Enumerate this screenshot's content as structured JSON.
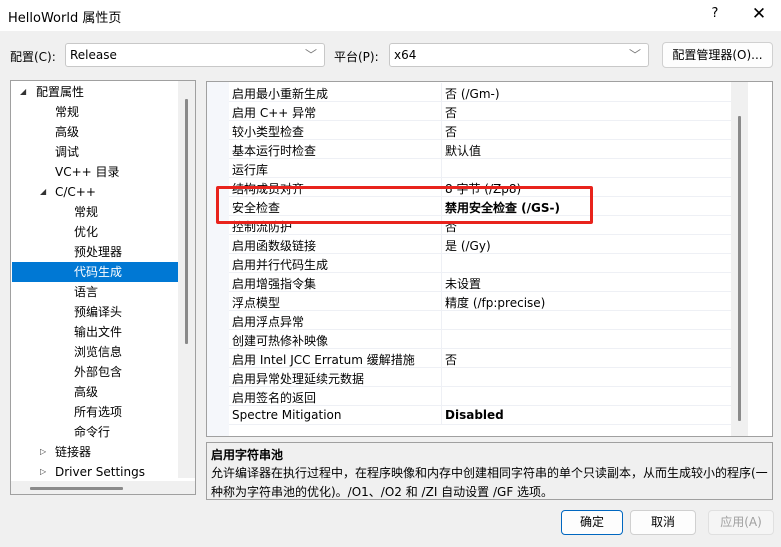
{
  "window": {
    "title": "HelloWorld 属性页",
    "help_label": "?",
    "close_label": "✕"
  },
  "toolbar": {
    "config_label": "配置(C):",
    "config_value": "Release",
    "platform_label": "平台(P):",
    "platform_value": "x64",
    "config_manager_label": "配置管理器(O)...",
    "chevron": "﹀"
  },
  "tree": {
    "items": [
      {
        "label": "配置属性",
        "expanded": true
      },
      {
        "label": "常规"
      },
      {
        "label": "高级"
      },
      {
        "label": "调试"
      },
      {
        "label": "VC++ 目录"
      },
      {
        "label": "C/C++",
        "expanded": true
      },
      {
        "label": "常规"
      },
      {
        "label": "优化"
      },
      {
        "label": "预处理器"
      },
      {
        "label": "代码生成",
        "selected": true
      },
      {
        "label": "语言"
      },
      {
        "label": "预编译头"
      },
      {
        "label": "输出文件"
      },
      {
        "label": "浏览信息"
      },
      {
        "label": "外部包含"
      },
      {
        "label": "高级"
      },
      {
        "label": "所有选项"
      },
      {
        "label": "命令行"
      },
      {
        "label": "链接器",
        "expanded": false
      },
      {
        "label": "Driver Settings",
        "expanded": false
      }
    ],
    "expanded_glyph": "◢",
    "collapsed_glyph": "▷"
  },
  "properties": [
    {
      "name": "启用最小重新生成",
      "value": "否 (/Gm-)"
    },
    {
      "name": "启用 C++ 异常",
      "value": "否"
    },
    {
      "name": "较小类型检查",
      "value": "否"
    },
    {
      "name": "基本运行时检查",
      "value": "默认值"
    },
    {
      "name": "运行库",
      "value": ""
    },
    {
      "name": "结构成员对齐",
      "value": "8 字节 (/Zp8)"
    },
    {
      "name": "安全检查",
      "value": "禁用安全检查 (/GS-)",
      "bold": true
    },
    {
      "name": "控制流防护",
      "value": "否"
    },
    {
      "name": "启用函数级链接",
      "value": "是 (/Gy)"
    },
    {
      "name": "启用并行代码生成",
      "value": ""
    },
    {
      "name": "启用增强指令集",
      "value": "未设置"
    },
    {
      "name": "浮点模型",
      "value": "精度 (/fp:precise)"
    },
    {
      "name": "启用浮点异常",
      "value": ""
    },
    {
      "name": "创建可热修补映像",
      "value": ""
    },
    {
      "name": "启用 Intel JCC Erratum 缓解措施",
      "value": "否"
    },
    {
      "name": "启用异常处理延续元数据",
      "value": ""
    },
    {
      "name": "启用签名的返回",
      "value": ""
    },
    {
      "name": "Spectre Mitigation",
      "value": "Disabled",
      "bold": true
    }
  ],
  "description": {
    "title": "启用字符串池",
    "text": "允许编译器在执行过程中，在程序映像和内存中创建相同字符串的单个只读副本，从而生成较小的程序(一种称为字符串池的优化)。/O1、/O2 和 /ZI 自动设置 /GF 选项。"
  },
  "buttons": {
    "ok": "确定",
    "cancel": "取消",
    "apply": "应用(A)"
  },
  "colors": {
    "selection": "#0078d4",
    "highlight_box": "#e8231c"
  }
}
